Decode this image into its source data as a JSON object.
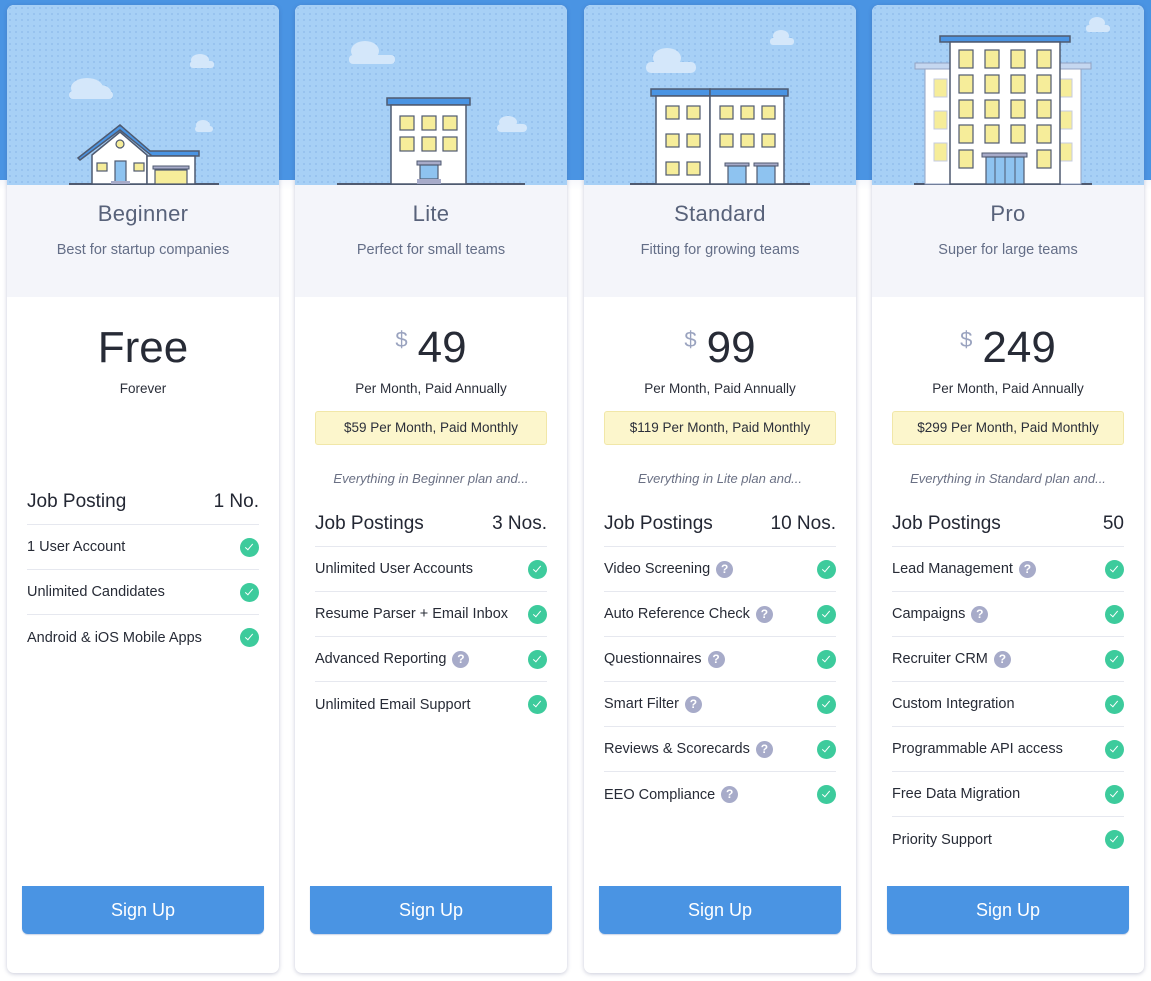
{
  "colors": {
    "backdrop": "#4a94e3",
    "sky": "#a7d0f6",
    "header_bg": "#f4f5fa",
    "button": "#4a94e3",
    "check": "#3dcb9c",
    "help": "#a7abc9",
    "monthly_bg": "#fcf6cc"
  },
  "plans": [
    {
      "name": "Beginner",
      "tagline": "Best for startup companies",
      "illustration": "house-icon",
      "price": "Free",
      "currency": "",
      "billing": "Forever",
      "monthly": "",
      "everything": "",
      "job_label": "Job Posting",
      "job_value": "1 No.",
      "features": [
        {
          "label": "1 User Account",
          "help": false,
          "included": true
        },
        {
          "label": "Unlimited Candidates",
          "help": false,
          "included": true
        },
        {
          "label": "Android & iOS Mobile Apps",
          "help": false,
          "included": true
        }
      ],
      "cta": "Sign Up"
    },
    {
      "name": "Lite",
      "tagline": "Perfect for small teams",
      "illustration": "small-building-icon",
      "price": "49",
      "currency": "$",
      "billing": "Per Month, Paid Annually",
      "monthly": "$59 Per Month, Paid Monthly",
      "everything": "Everything in Beginner plan and...",
      "job_label": "Job Postings",
      "job_value": "3 Nos.",
      "features": [
        {
          "label": "Unlimited User Accounts",
          "help": false,
          "included": true
        },
        {
          "label": "Resume Parser + Email Inbox",
          "help": false,
          "included": true
        },
        {
          "label": "Advanced Reporting",
          "help": true,
          "included": true
        },
        {
          "label": "Unlimited Email Support",
          "help": false,
          "included": true
        }
      ],
      "cta": "Sign Up"
    },
    {
      "name": "Standard",
      "tagline": "Fitting for growing teams",
      "illustration": "medium-building-icon",
      "price": "99",
      "currency": "$",
      "billing": "Per Month, Paid Annually",
      "monthly": "$119 Per Month, Paid Monthly",
      "everything": "Everything in Lite plan and...",
      "job_label": "Job Postings",
      "job_value": "10 Nos.",
      "features": [
        {
          "label": "Video Screening",
          "help": true,
          "included": true
        },
        {
          "label": "Auto Reference Check",
          "help": true,
          "included": true
        },
        {
          "label": "Questionnaires",
          "help": true,
          "included": true
        },
        {
          "label": "Smart Filter",
          "help": true,
          "included": true
        },
        {
          "label": "Reviews & Scorecards",
          "help": true,
          "included": true
        },
        {
          "label": "EEO Compliance",
          "help": true,
          "included": true
        }
      ],
      "cta": "Sign Up"
    },
    {
      "name": "Pro",
      "tagline": "Super for large teams",
      "illustration": "tall-building-icon",
      "price": "249",
      "currency": "$",
      "billing": "Per Month, Paid Annually",
      "monthly": "$299 Per Month, Paid Monthly",
      "everything": "Everything in Standard plan and...",
      "job_label": "Job Postings",
      "job_value": "50",
      "features": [
        {
          "label": "Lead Management",
          "help": true,
          "included": true
        },
        {
          "label": "Campaigns",
          "help": true,
          "included": true
        },
        {
          "label": "Recruiter CRM",
          "help": true,
          "included": true
        },
        {
          "label": "Custom Integration",
          "help": false,
          "included": true
        },
        {
          "label": "Programmable API access",
          "help": false,
          "included": true
        },
        {
          "label": "Free Data Migration",
          "help": false,
          "included": true
        },
        {
          "label": "Priority Support",
          "help": false,
          "included": true
        }
      ],
      "cta": "Sign Up"
    }
  ],
  "help_glyph": "?"
}
